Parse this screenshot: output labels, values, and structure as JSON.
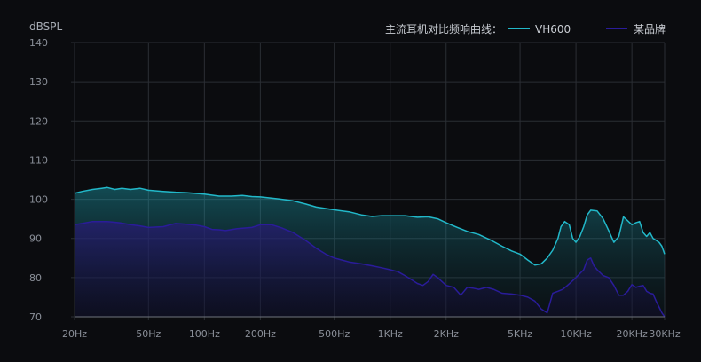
{
  "colors": {
    "background": "#0b0c0f",
    "grid": "#2b2e34",
    "axis": "#6f747c",
    "vh600": "#22b8c9",
    "brand": "#2a1c9a"
  },
  "chart_data": {
    "type": "area",
    "ylabel": "dBSPL",
    "ylim": [
      70,
      140
    ],
    "yticks": [
      70,
      80,
      90,
      100,
      110,
      120,
      130,
      140
    ],
    "xscale": "log",
    "xlim_hz": [
      20,
      30000
    ],
    "xticks": [
      {
        "hz": 20,
        "label": "20Hz"
      },
      {
        "hz": 50,
        "label": "50Hz"
      },
      {
        "hz": 100,
        "label": "100Hz"
      },
      {
        "hz": 200,
        "label": "200Hz"
      },
      {
        "hz": 500,
        "label": "500Hz"
      },
      {
        "hz": 1000,
        "label": "1KHz"
      },
      {
        "hz": 2000,
        "label": "2KHz"
      },
      {
        "hz": 5000,
        "label": "5KHz"
      },
      {
        "hz": 10000,
        "label": "10KHz"
      },
      {
        "hz": 20000,
        "label": "20KHz"
      },
      {
        "hz": 30000,
        "label": "30KHz"
      }
    ],
    "grid": true,
    "legend": {
      "position": "top-right",
      "title": "主流耳机对比频响曲线："
    },
    "series": [
      {
        "name": "VH600",
        "color": "#22b8c9",
        "points": [
          [
            20,
            101.5
          ],
          [
            22,
            102
          ],
          [
            25,
            102.5
          ],
          [
            28,
            102.8
          ],
          [
            30,
            103
          ],
          [
            33,
            102.5
          ],
          [
            36,
            102.8
          ],
          [
            40,
            102.5
          ],
          [
            45,
            102.8
          ],
          [
            50,
            102.3
          ],
          [
            60,
            102
          ],
          [
            70,
            101.8
          ],
          [
            80,
            101.7
          ],
          [
            100,
            101.3
          ],
          [
            120,
            100.8
          ],
          [
            140,
            100.8
          ],
          [
            160,
            101
          ],
          [
            180,
            100.7
          ],
          [
            200,
            100.6
          ],
          [
            250,
            100.1
          ],
          [
            300,
            99.6
          ],
          [
            350,
            98.8
          ],
          [
            400,
            98
          ],
          [
            500,
            97.3
          ],
          [
            600,
            96.8
          ],
          [
            700,
            96
          ],
          [
            800,
            95.6
          ],
          [
            900,
            95.8
          ],
          [
            1000,
            95.8
          ],
          [
            1200,
            95.8
          ],
          [
            1400,
            95.4
          ],
          [
            1600,
            95.5
          ],
          [
            1800,
            95
          ],
          [
            2000,
            94
          ],
          [
            2300,
            92.8
          ],
          [
            2600,
            91.8
          ],
          [
            3000,
            91
          ],
          [
            3500,
            89.5
          ],
          [
            4000,
            88
          ],
          [
            4500,
            86.8
          ],
          [
            5000,
            86
          ],
          [
            5500,
            84.5
          ],
          [
            6000,
            83.2
          ],
          [
            6500,
            83.5
          ],
          [
            7000,
            85
          ],
          [
            7500,
            87
          ],
          [
            8000,
            90
          ],
          [
            8300,
            93
          ],
          [
            8700,
            94.3
          ],
          [
            9200,
            93.5
          ],
          [
            9600,
            90
          ],
          [
            10000,
            89
          ],
          [
            10500,
            90.5
          ],
          [
            11000,
            93
          ],
          [
            11500,
            96
          ],
          [
            12000,
            97.2
          ],
          [
            13000,
            97
          ],
          [
            14000,
            95
          ],
          [
            15000,
            92
          ],
          [
            16000,
            89
          ],
          [
            17000,
            90.5
          ],
          [
            18000,
            95.5
          ],
          [
            19000,
            94.5
          ],
          [
            20000,
            93.5
          ],
          [
            21000,
            94
          ],
          [
            22000,
            94.3
          ],
          [
            23000,
            91.5
          ],
          [
            24000,
            90.5
          ],
          [
            25000,
            91.5
          ],
          [
            26000,
            90
          ],
          [
            27000,
            89.5
          ],
          [
            28000,
            89
          ],
          [
            29000,
            88
          ],
          [
            30000,
            86
          ]
        ]
      },
      {
        "name": "某品牌",
        "color": "#2a1c9a",
        "points": [
          [
            20,
            93.5
          ],
          [
            22,
            93.8
          ],
          [
            25,
            94.3
          ],
          [
            30,
            94.3
          ],
          [
            35,
            94
          ],
          [
            40,
            93.5
          ],
          [
            45,
            93.2
          ],
          [
            50,
            92.8
          ],
          [
            60,
            93
          ],
          [
            70,
            93.8
          ],
          [
            80,
            93.6
          ],
          [
            90,
            93.4
          ],
          [
            100,
            93
          ],
          [
            110,
            92.3
          ],
          [
            120,
            92.2
          ],
          [
            130,
            92
          ],
          [
            150,
            92.5
          ],
          [
            180,
            92.8
          ],
          [
            200,
            93.5
          ],
          [
            230,
            93.5
          ],
          [
            260,
            92.7
          ],
          [
            300,
            91.5
          ],
          [
            350,
            89.5
          ],
          [
            400,
            87.5
          ],
          [
            450,
            86
          ],
          [
            500,
            85
          ],
          [
            600,
            84
          ],
          [
            700,
            83.5
          ],
          [
            800,
            83
          ],
          [
            900,
            82.5
          ],
          [
            1000,
            82
          ],
          [
            1100,
            81.5
          ],
          [
            1200,
            80.5
          ],
          [
            1300,
            79.5
          ],
          [
            1400,
            78.5
          ],
          [
            1500,
            78
          ],
          [
            1600,
            79
          ],
          [
            1700,
            80.8
          ],
          [
            1800,
            80
          ],
          [
            2000,
            78
          ],
          [
            2200,
            77.5
          ],
          [
            2400,
            75.5
          ],
          [
            2600,
            77.5
          ],
          [
            2800,
            77.3
          ],
          [
            3000,
            77
          ],
          [
            3300,
            77.5
          ],
          [
            3600,
            77
          ],
          [
            4000,
            76
          ],
          [
            4500,
            75.8
          ],
          [
            5000,
            75.5
          ],
          [
            5500,
            75
          ],
          [
            6000,
            74
          ],
          [
            6500,
            72
          ],
          [
            7000,
            71
          ],
          [
            7200,
            73
          ],
          [
            7500,
            76
          ],
          [
            8000,
            76.5
          ],
          [
            8500,
            77
          ],
          [
            9000,
            78
          ],
          [
            9500,
            79
          ],
          [
            10000,
            80
          ],
          [
            10500,
            81
          ],
          [
            11000,
            82
          ],
          [
            11500,
            84.5
          ],
          [
            12000,
            85
          ],
          [
            12500,
            83
          ],
          [
            13000,
            82
          ],
          [
            14000,
            80.5
          ],
          [
            15000,
            80
          ],
          [
            16000,
            78
          ],
          [
            17000,
            75.5
          ],
          [
            18000,
            75.5
          ],
          [
            19000,
            76.5
          ],
          [
            20000,
            78.2
          ],
          [
            21000,
            77.5
          ],
          [
            22000,
            77.8
          ],
          [
            23000,
            78
          ],
          [
            24000,
            76.5
          ],
          [
            25000,
            76
          ],
          [
            26000,
            75.8
          ],
          [
            27000,
            74
          ],
          [
            28000,
            72.5
          ],
          [
            29000,
            71
          ],
          [
            30000,
            70
          ]
        ]
      }
    ]
  }
}
